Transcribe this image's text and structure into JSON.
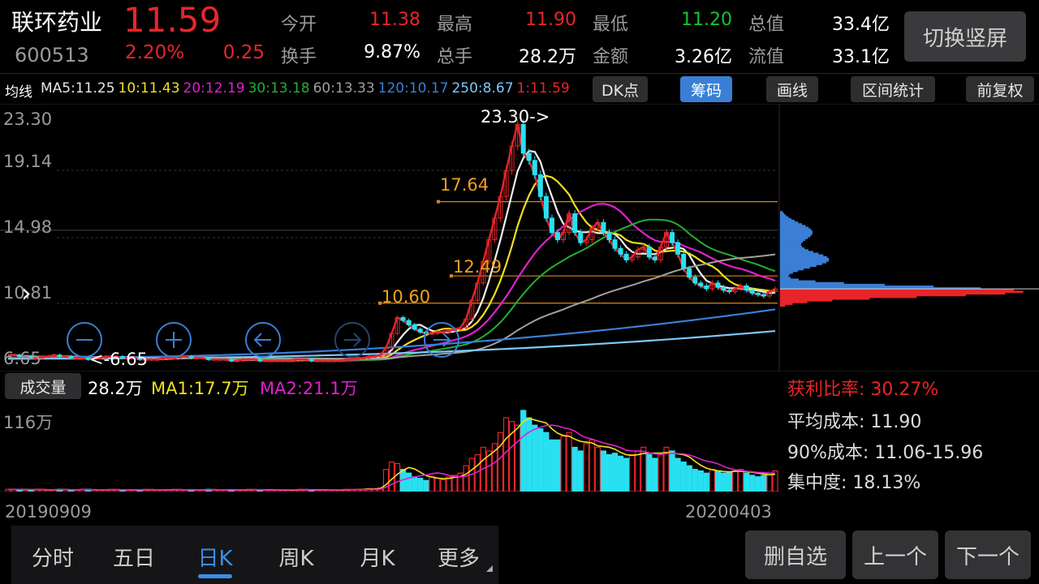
{
  "header": {
    "stock_name": "联环药业",
    "stock_code": "600513",
    "price": "11.59",
    "change_pct": "2.20%",
    "change": "0.25",
    "quote": [
      {
        "label": "今开",
        "value": "11.38",
        "color": "red"
      },
      {
        "label": "最高",
        "value": "11.90",
        "color": "red"
      },
      {
        "label": "最低",
        "value": "11.20",
        "color": "green"
      },
      {
        "label": "总值",
        "value": "33.4亿",
        "color": "white"
      },
      {
        "label": "换手",
        "value": "9.87%",
        "color": "white"
      },
      {
        "label": "总手",
        "value": "28.2万",
        "color": "white"
      },
      {
        "label": "金额",
        "value": "3.26亿",
        "color": "white"
      },
      {
        "label": "流值",
        "value": "33.1亿",
        "color": "white"
      }
    ],
    "switch_label": "切换竖屏"
  },
  "ma_bar": {
    "title": "均线",
    "items": [
      {
        "text": "MA5:11.25",
        "color": "#e6e6e6"
      },
      {
        "text": "10:11.43",
        "color": "#f0e020"
      },
      {
        "text": "20:12.19",
        "color": "#e020d0"
      },
      {
        "text": "30:13.18",
        "color": "#22b030"
      },
      {
        "text": "60:13.33",
        "color": "#a0a0a0"
      },
      {
        "text": "120:10.17",
        "color": "#3a7fd5"
      },
      {
        "text": "250:8.67",
        "color": "#7ec8f8"
      },
      {
        "text": "1:11.59",
        "color": "#e8252a"
      }
    ],
    "buttons": [
      "DK点",
      "筹码",
      "画线",
      "区间统计",
      "前复权"
    ],
    "selected_button": "筹码"
  },
  "price_axis": [
    "23.30",
    "19.14",
    "14.98",
    "10.81",
    "6.65"
  ],
  "annotations": {
    "high": "23.30->",
    "low": "<-6.65",
    "levels": [
      {
        "label": "17.64",
        "value": 17.64
      },
      {
        "label": "12.49",
        "value": 12.49
      },
      {
        "label": "10.60",
        "value": 10.6
      }
    ]
  },
  "chart_data": {
    "type": "line",
    "price_range": [
      6.65,
      23.3
    ],
    "date_start": "20190909",
    "date_end": "20200403",
    "close_series": [
      7.0,
      7.0,
      6.9,
      6.9,
      6.8,
      6.8,
      6.9,
      6.9,
      7.0,
      6.9,
      6.9,
      6.8,
      6.8,
      6.8,
      6.7,
      6.8,
      6.8,
      6.9,
      6.9,
      6.9,
      6.8,
      6.8,
      6.8,
      6.7,
      6.7,
      6.7,
      6.7,
      6.8,
      6.8,
      6.8,
      6.9,
      6.9,
      6.8,
      6.8,
      6.8,
      6.7,
      6.7,
      6.7,
      6.7,
      6.6,
      6.6,
      6.7,
      6.7,
      6.7,
      6.6,
      6.6,
      6.6,
      6.6,
      6.6,
      6.6,
      6.7,
      6.7,
      6.7,
      6.6,
      6.6,
      6.6,
      6.6,
      6.6,
      6.6,
      6.7,
      6.7,
      6.8,
      6.8,
      6.9,
      6.9,
      7.0,
      7.5,
      8.5,
      9.6,
      9.4,
      9.1,
      8.8,
      8.6,
      8.5,
      8.5,
      8.6,
      8.6,
      8.7,
      8.8,
      8.9,
      9.5,
      10.8,
      12.0,
      13.5,
      15.0,
      16.5,
      18.0,
      19.8,
      21.5,
      23.0,
      21.0,
      20.5,
      19.5,
      18.0,
      16.5,
      15.5,
      15.0,
      15.5,
      16.8,
      15.5,
      14.8,
      15.0,
      15.8,
      16.2,
      15.5,
      15.0,
      14.4,
      14.0,
      13.6,
      13.8,
      14.3,
      14.5,
      13.8,
      13.6,
      14.5,
      15.5,
      14.8,
      14.0,
      13.0,
      12.4,
      12.0,
      11.8,
      11.6,
      12.0,
      11.7,
      11.5,
      11.4,
      11.6,
      11.8,
      11.5,
      11.3,
      11.2,
      11.1,
      11.4,
      11.59
    ],
    "indicators": [
      {
        "name": "MA5",
        "value": 11.25
      },
      {
        "name": "MA10",
        "value": 11.43
      },
      {
        "name": "MA20",
        "value": 12.19
      },
      {
        "name": "MA30",
        "value": 13.18
      },
      {
        "name": "MA60",
        "value": 13.33
      },
      {
        "name": "MA120",
        "value": 10.17
      },
      {
        "name": "MA250",
        "value": 8.67
      }
    ],
    "volume_max": "116万",
    "volume_series": [
      3,
      3,
      3,
      2,
      2,
      3,
      3,
      2,
      2,
      3,
      3,
      2,
      2,
      3,
      3,
      2,
      2,
      2,
      3,
      3,
      2,
      2,
      2,
      2,
      3,
      3,
      2,
      2,
      2,
      3,
      3,
      2,
      2,
      2,
      2,
      3,
      3,
      2,
      2,
      2,
      2,
      2,
      3,
      3,
      2,
      2,
      2,
      2,
      2,
      2,
      2,
      3,
      3,
      2,
      2,
      2,
      2,
      2,
      2,
      3,
      3,
      3,
      3,
      4,
      4,
      5,
      30,
      40,
      38,
      30,
      25,
      20,
      18,
      15,
      20,
      18,
      16,
      20,
      22,
      25,
      35,
      45,
      50,
      60,
      55,
      65,
      80,
      100,
      95,
      90,
      110,
      100,
      90,
      85,
      80,
      70,
      70,
      75,
      80,
      60,
      55,
      65,
      70,
      60,
      55,
      50,
      52,
      48,
      45,
      50,
      55,
      60,
      50,
      45,
      50,
      60,
      55,
      45,
      40,
      35,
      30,
      28,
      25,
      30,
      28,
      25,
      26,
      28,
      30,
      25,
      22,
      20,
      22,
      25,
      28
    ]
  },
  "volume_panel": {
    "label": "成交量",
    "current": "28.2万",
    "ma1": "MA1:17.7万",
    "ma2": "MA2:21.1万",
    "max": "116万"
  },
  "chip_stats": {
    "profit_ratio": "获利比率: 30.27%",
    "avg_cost": "平均成本: 11.90",
    "cost_90": "90%成本: 11.06-15.96",
    "concentration": "集中度: 18.13%"
  },
  "dates": {
    "start": "20190909",
    "end": "20200403"
  },
  "tabs": [
    "分时",
    "五日",
    "日K",
    "周K",
    "月K",
    "更多"
  ],
  "selected_tab": "日K",
  "actions": [
    "删自选",
    "上一个",
    "下一个"
  ],
  "icons": [
    "zoom-out-icon",
    "zoom-in-icon",
    "arrow-left-icon",
    "arrow-right-icon",
    "arrow-left-icon",
    "chevron-right-icon"
  ]
}
